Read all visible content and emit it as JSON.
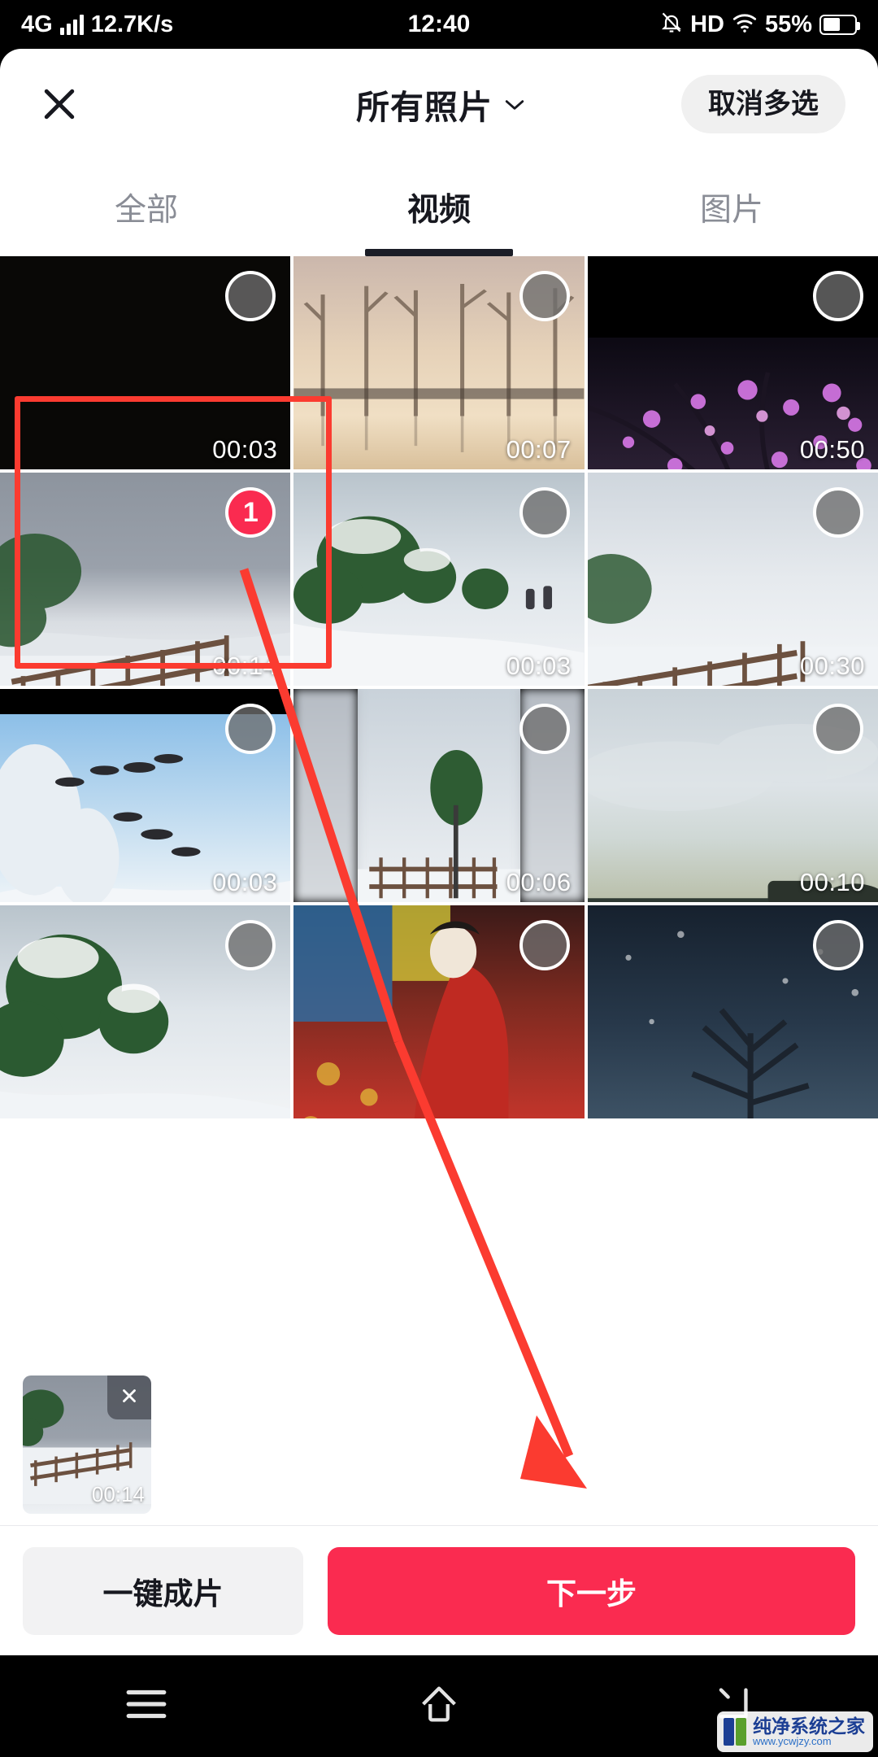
{
  "status_bar": {
    "network": "4G",
    "speed": "12.7K/s",
    "time": "12:40",
    "hd": "HD",
    "battery_percent": "55%",
    "icons": [
      "signal-bars-icon",
      "mute-bell-icon",
      "hd-icon",
      "wifi-icon",
      "battery-icon"
    ]
  },
  "header": {
    "close_icon": "close-icon",
    "title": "所有照片",
    "dropdown_icon": "chevron-down-icon",
    "multi_select_label": "取消多选"
  },
  "tabs": [
    {
      "label": "全部",
      "active": false
    },
    {
      "label": "视频",
      "active": true
    },
    {
      "label": "图片",
      "active": false
    }
  ],
  "grid": {
    "items": [
      {
        "duration": "00:03",
        "selected": false,
        "style": "dark"
      },
      {
        "duration": "00:07",
        "selected": false,
        "style": "dawn"
      },
      {
        "duration": "00:50",
        "selected": false,
        "style": "nightpink"
      },
      {
        "duration": "00:14",
        "selected": true,
        "badge": "1",
        "style": "snow-gray"
      },
      {
        "duration": "00:03",
        "selected": false,
        "style": "greensnow"
      },
      {
        "duration": "00:30",
        "selected": false,
        "style": "snow-light"
      },
      {
        "duration": "00:03",
        "selected": false,
        "style": "sky-blue"
      },
      {
        "duration": "00:06",
        "selected": false,
        "style": "snow-light"
      },
      {
        "duration": "00:10",
        "selected": false,
        "style": "lake"
      },
      {
        "duration": "",
        "selected": false,
        "style": "greensnow"
      },
      {
        "duration": "",
        "selected": false,
        "style": "fest"
      },
      {
        "duration": "",
        "selected": false,
        "style": "nightsky"
      }
    ]
  },
  "selected_tray": {
    "items": [
      {
        "duration": "00:14",
        "remove_icon": "close-icon"
      }
    ]
  },
  "action_bar": {
    "secondary_label": "一键成片",
    "primary_label": "下一步"
  },
  "nav_bar": {
    "menu_icon": "menu-icon",
    "home_icon": "home-icon",
    "back_icon": "back-icon"
  },
  "annotation": {
    "rectangle_color": "#fb3b30",
    "arrow_color": "#fb3b30"
  },
  "watermark": {
    "name": "纯净系统之家",
    "url": "www.ycwjzy.com"
  },
  "colors": {
    "accent": "#fa2b50",
    "tab_active": "#17181f",
    "tab_inactive": "#8a8d96",
    "chip_bg": "#f0f0f0"
  }
}
